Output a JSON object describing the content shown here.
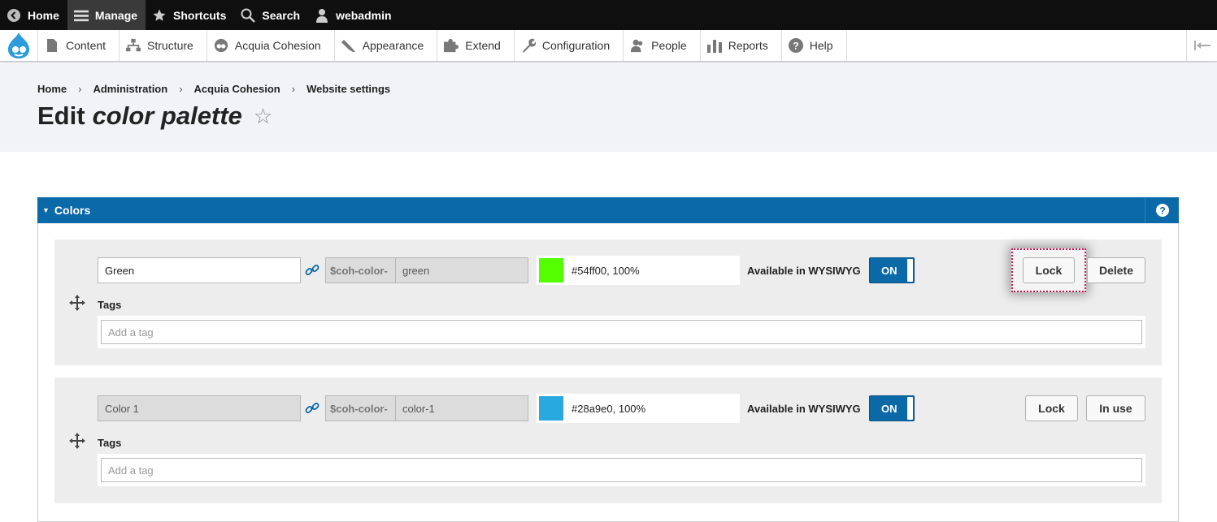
{
  "toolbar": {
    "home": "Home",
    "manage": "Manage",
    "shortcuts": "Shortcuts",
    "search": "Search",
    "user": "webadmin"
  },
  "tray": {
    "items": [
      "Content",
      "Structure",
      "Acquia Cohesion",
      "Appearance",
      "Extend",
      "Configuration",
      "People",
      "Reports",
      "Help"
    ]
  },
  "breadcrumb": [
    "Home",
    "Administration",
    "Acquia Cohesion",
    "Website settings"
  ],
  "page": {
    "title_plain": "Edit",
    "title_italic": "color palette"
  },
  "panel": {
    "title": "Colors"
  },
  "colors": [
    {
      "name": "Green",
      "name_disabled": false,
      "var_prefix": "$coh-color-",
      "var_suffix": "green",
      "swatch": "#54ff00",
      "value": "#54ff00, 100%",
      "wysiwyg_label": "Available in WYSIWYG",
      "toggle": "ON",
      "lock_label": "Lock",
      "action_label": "Delete",
      "tags_label": "Tags",
      "tags_placeholder": "Add a tag"
    },
    {
      "name": "Color 1",
      "name_disabled": true,
      "var_prefix": "$coh-color-",
      "var_suffix": "color-1",
      "swatch": "#28a9e0",
      "value": "#28a9e0, 100%",
      "wysiwyg_label": "Available in WYSIWYG",
      "toggle": "ON",
      "lock_label": "Lock",
      "action_label": "In use",
      "tags_label": "Tags",
      "tags_placeholder": "Add a tag"
    }
  ],
  "theme": {
    "accent": "#0b69a8",
    "focus": "#d1165c"
  }
}
